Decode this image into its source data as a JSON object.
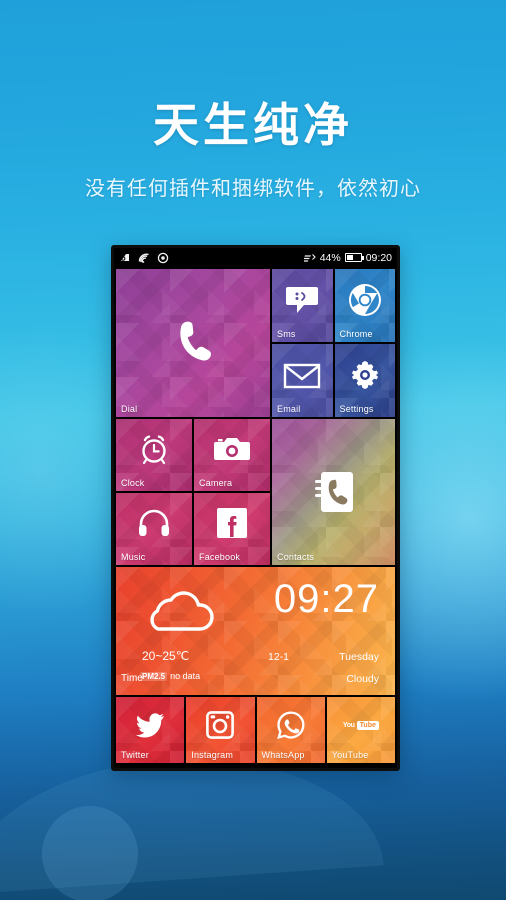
{
  "promo": {
    "headline": "天生纯净",
    "subhead": "没有任何插件和捆绑软件，依然初心"
  },
  "phone": {
    "statusbar": {
      "icons": [
        "sync-icon",
        "wifi-icon",
        "location-icon",
        "data-transfer-icon"
      ],
      "battery_percent": "44%",
      "time": "09:20"
    },
    "tiles": {
      "dial": {
        "label": "Dial",
        "icon": "phone-icon",
        "color": "#a4479f"
      },
      "sms": {
        "label": "Sms",
        "icon": "message-bubble-icon",
        "color": "#6552a8"
      },
      "chrome": {
        "label": "Chrome",
        "icon": "chrome-icon",
        "color": "#2f86c9"
      },
      "email": {
        "label": "Email",
        "icon": "envelope-icon",
        "color": "#5257ab"
      },
      "settings": {
        "label": "Settings",
        "icon": "gear-icon",
        "color": "#37559f"
      },
      "clock": {
        "label": "Clock",
        "icon": "alarm-clock-icon",
        "color": "#be3a7d"
      },
      "camera": {
        "label": "Camera",
        "icon": "camera-icon",
        "color": "#c43b79"
      },
      "music": {
        "label": "Music",
        "icon": "headphones-icon",
        "color": "#cc3b72"
      },
      "facebook": {
        "label": "Facebook",
        "icon": "facebook-icon",
        "color": "#d03c6f"
      },
      "contacts": {
        "label": "Contacts",
        "icon": "contacts-book-icon",
        "color": "#b7b06d"
      },
      "twitter": {
        "label": "Twitter",
        "icon": "twitter-bird-icon",
        "color": "#e0303c"
      },
      "instagram": {
        "label": "Instagram",
        "icon": "instagram-camera-icon",
        "color": "#f25534"
      },
      "whatsapp": {
        "label": "WhatsApp",
        "icon": "whatsapp-icon",
        "color": "#f77b36"
      },
      "youtube": {
        "label": "YouTube",
        "icon": "youtube-icon",
        "color": "#fba942",
        "badge_word": "You",
        "badge_box": "Tube"
      }
    },
    "weather": {
      "icon": "cloud-icon",
      "time": "09:27",
      "temperature": "20~25℃",
      "date": "12-1",
      "weekday": "Tuesday",
      "time_label": "Time",
      "pm_tag": "PM2.5",
      "pm_value": "no data",
      "condition": "Cloudy"
    }
  }
}
